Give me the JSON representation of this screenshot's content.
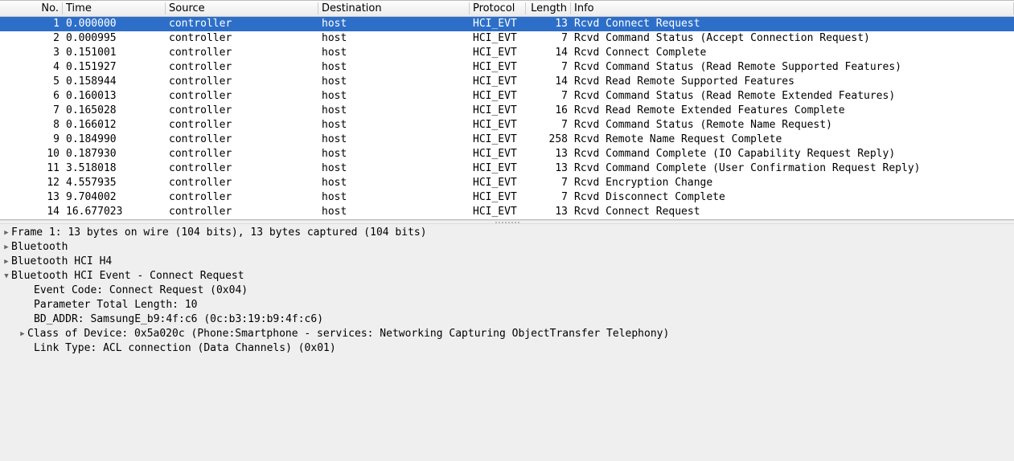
{
  "columns": {
    "no": "No.",
    "time": "Time",
    "source": "Source",
    "destination": "Destination",
    "protocol": "Protocol",
    "length": "Length",
    "info": "Info"
  },
  "packets": [
    {
      "no": "1",
      "time": "0.000000",
      "src": "controller",
      "dst": "host",
      "proto": "HCI_EVT",
      "len": "13",
      "info": "Rcvd Connect Request",
      "selected": true
    },
    {
      "no": "2",
      "time": "0.000995",
      "src": "controller",
      "dst": "host",
      "proto": "HCI_EVT",
      "len": "7",
      "info": "Rcvd Command Status (Accept Connection Request)"
    },
    {
      "no": "3",
      "time": "0.151001",
      "src": "controller",
      "dst": "host",
      "proto": "HCI_EVT",
      "len": "14",
      "info": "Rcvd Connect Complete"
    },
    {
      "no": "4",
      "time": "0.151927",
      "src": "controller",
      "dst": "host",
      "proto": "HCI_EVT",
      "len": "7",
      "info": "Rcvd Command Status (Read Remote Supported Features)"
    },
    {
      "no": "5",
      "time": "0.158944",
      "src": "controller",
      "dst": "host",
      "proto": "HCI_EVT",
      "len": "14",
      "info": "Rcvd Read Remote Supported Features"
    },
    {
      "no": "6",
      "time": "0.160013",
      "src": "controller",
      "dst": "host",
      "proto": "HCI_EVT",
      "len": "7",
      "info": "Rcvd Command Status (Read Remote Extended Features)"
    },
    {
      "no": "7",
      "time": "0.165028",
      "src": "controller",
      "dst": "host",
      "proto": "HCI_EVT",
      "len": "16",
      "info": "Rcvd Read Remote Extended Features Complete"
    },
    {
      "no": "8",
      "time": "0.166012",
      "src": "controller",
      "dst": "host",
      "proto": "HCI_EVT",
      "len": "7",
      "info": "Rcvd Command Status (Remote Name Request)"
    },
    {
      "no": "9",
      "time": "0.184990",
      "src": "controller",
      "dst": "host",
      "proto": "HCI_EVT",
      "len": "258",
      "info": "Rcvd Remote Name Request Complete"
    },
    {
      "no": "10",
      "time": "0.187930",
      "src": "controller",
      "dst": "host",
      "proto": "HCI_EVT",
      "len": "13",
      "info": "Rcvd Command Complete (IO Capability Request Reply)"
    },
    {
      "no": "11",
      "time": "3.518018",
      "src": "controller",
      "dst": "host",
      "proto": "HCI_EVT",
      "len": "13",
      "info": "Rcvd Command Complete (User Confirmation Request Reply)"
    },
    {
      "no": "12",
      "time": "4.557935",
      "src": "controller",
      "dst": "host",
      "proto": "HCI_EVT",
      "len": "7",
      "info": "Rcvd Encryption Change"
    },
    {
      "no": "13",
      "time": "9.704002",
      "src": "controller",
      "dst": "host",
      "proto": "HCI_EVT",
      "len": "7",
      "info": "Rcvd Disconnect Complete"
    },
    {
      "no": "14",
      "time": "16.677023",
      "src": "controller",
      "dst": "host",
      "proto": "HCI_EVT",
      "len": "13",
      "info": "Rcvd Connect Request"
    }
  ],
  "details": {
    "frame": "Frame 1: 13 bytes on wire (104 bits), 13 bytes captured (104 bits)",
    "bluetooth": "Bluetooth",
    "hci_h4": "Bluetooth HCI H4",
    "hci_event": "Bluetooth HCI Event - Connect Request",
    "event_code": "Event Code: Connect Request (0x04)",
    "param_len": "Parameter Total Length: 10",
    "bd_addr": "BD_ADDR: SamsungE_b9:4f:c6 (0c:b3:19:b9:4f:c6)",
    "class_of_device": "Class of Device: 0x5a020c (Phone:Smartphone - services: Networking Capturing ObjectTransfer Telephony)",
    "link_type": "Link Type: ACL connection (Data Channels) (0x01)"
  }
}
